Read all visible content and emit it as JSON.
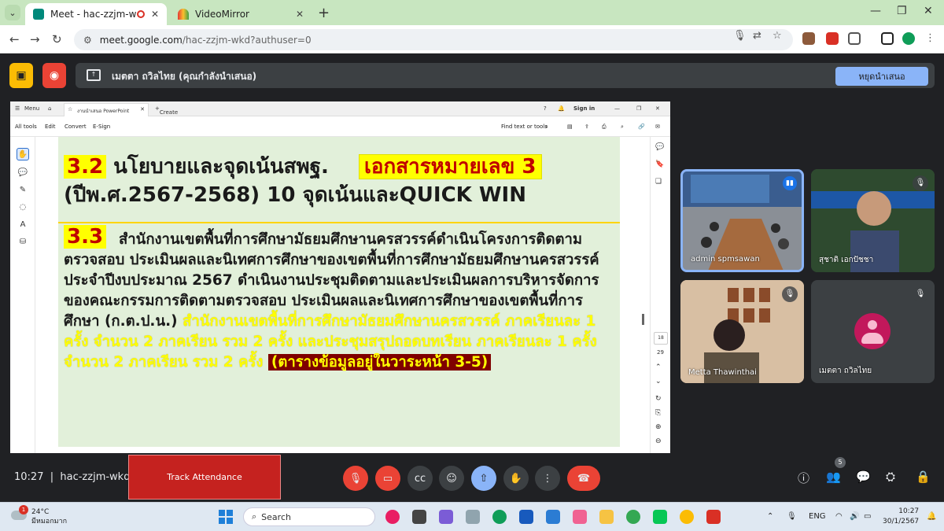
{
  "browser": {
    "tabs": [
      {
        "title": "Meet - hac-zzjm-wkd",
        "active": true
      },
      {
        "title": "VideoMirror",
        "active": false
      }
    ],
    "url_host": "meet.google.com",
    "url_path": "/hac-zzjm-wkd?authuser=0"
  },
  "presenting": {
    "presenter_label": "เมตตา ถวิลไทย (คุณกำลังนำเสนอ)",
    "stop_button": "หยุดนำเสนอ"
  },
  "pdf_viewer": {
    "menu": "Menu",
    "tab_title": "งานนำเสนอ PowerPoint",
    "create": "Create",
    "sign_in": "Sign in",
    "toolbar": [
      "All tools",
      "Edit",
      "Convert",
      "E-Sign"
    ],
    "find_text": "Find text or tools",
    "page_current": "18",
    "page_total": "29"
  },
  "slide": {
    "sec32_num": "3.2",
    "sec32_title": "นโยบายและจุดเน้นสพฐ.",
    "doc_label": "เอกสารหมายเลข 3",
    "sec32_line2": "(ปีพ.ศ.2567-2568) 10 จุดเน้นและQUICK WIN",
    "sec33_num": "3.3",
    "sec33_black": "สำนักงานเขตพื้นที่การศึกษามัธยมศึกษานครสวรรค์ดำเนินโครงการติดตาม ตรวจสอบ ประเมินผลและนิเทศการศึกษาของเขตพื้นที่การศึกษามัธยมศึกษานครสวรรค์ ประจำปีงบประมาณ 2567 ดำเนินงานประชุมติดตามและประเมินผลการบริหารจัดการของคณะกรรมการติดตามตรวจสอบ ประเมินผลและนิเทศการศึกษาของเขตพื้นที่การศึกษา (ก.ต.ป.น.)",
    "sec33_yellow": "สำนักงานเขตพื้นที่การศึกษามัธยมศึกษานครสวรรค์ ภาคเรียนละ 1 ครั้ง จำนวน 2 ภาคเรียน รวม 2 ครั้ง และประชุมสรุปถอดบทเรียน ภาคเรียนละ 1 ครั้ง จำนวน 2 ภาคเรียน รวม 2 ครั้ง",
    "sec33_note": "(ตารางข้อมูลอยู่ในวาระหน้า 3-5)"
  },
  "participants": [
    {
      "name": "admin spmsawan",
      "speaking": true,
      "muted": false
    },
    {
      "name": "สุชาติ เอกปัชชา",
      "speaking": false,
      "muted": true
    },
    {
      "name": "Metta Thawinthai",
      "speaking": false,
      "muted": true
    },
    {
      "name": "เมตตา ถวิลไทย",
      "speaking": false,
      "muted": true
    }
  ],
  "meeting": {
    "time": "10:27",
    "code": "hac-zzjm-wkd",
    "track_button": "Track Attendance",
    "participant_count": "5"
  },
  "taskbar": {
    "weather_temp": "24°C",
    "weather_desc": "มีหมอกมาก",
    "weather_badge": "1",
    "search_placeholder": "Search",
    "lang": "ENG",
    "time": "10:27",
    "date": "30/1/2567"
  },
  "colors": {
    "meet_bg": "#202124",
    "slide_bg": "#e2f0da",
    "highlight_yellow": "#ffff00",
    "end_call_red": "#ea4335",
    "present_blue": "#8ab4f8"
  }
}
